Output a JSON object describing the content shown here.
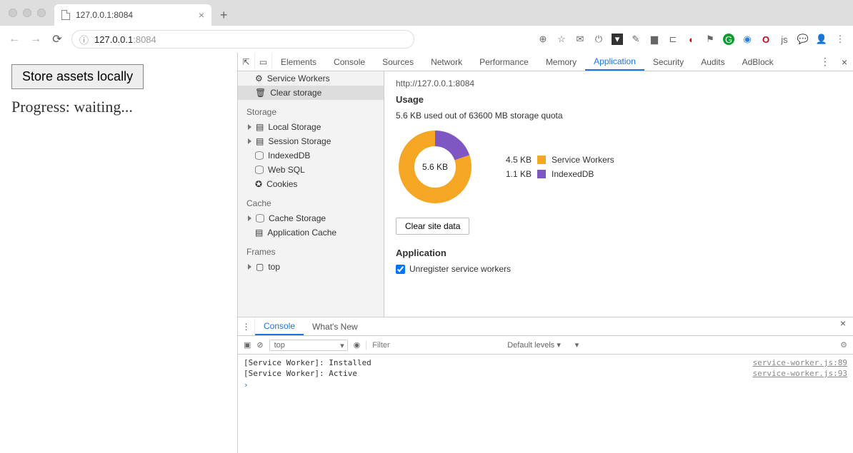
{
  "browser": {
    "tab_title": "127.0.0.1:8084",
    "address_host": "127.0.0.1",
    "address_port": ":8084"
  },
  "page": {
    "button_label": "Store assets locally",
    "progress_text": "Progress: waiting..."
  },
  "devtools": {
    "tabs": [
      "Elements",
      "Console",
      "Sources",
      "Network",
      "Performance",
      "Memory",
      "Application",
      "Security",
      "Audits",
      "AdBlock"
    ],
    "active_tab": "Application",
    "sidebar": {
      "top": [
        {
          "label": "Service Workers",
          "icon": "gear-icon"
        },
        {
          "label": "Clear storage",
          "icon": "trash-icon",
          "selected": true
        }
      ],
      "storage_label": "Storage",
      "storage": [
        {
          "label": "Local Storage",
          "expandable": true
        },
        {
          "label": "Session Storage",
          "expandable": true
        },
        {
          "label": "IndexedDB"
        },
        {
          "label": "Web SQL"
        },
        {
          "label": "Cookies"
        }
      ],
      "cache_label": "Cache",
      "cache": [
        {
          "label": "Cache Storage",
          "expandable": true
        },
        {
          "label": "Application Cache"
        }
      ],
      "frames_label": "Frames",
      "frames": [
        {
          "label": "top",
          "expandable": true
        }
      ]
    },
    "clear_storage": {
      "origin": "http://127.0.0.1:8084",
      "usage_heading": "Usage",
      "usage_line": "5.6 KB used out of 63600 MB storage quota",
      "donut_center": "5.6 KB",
      "legend": [
        {
          "value": "4.5 KB",
          "label": "Service Workers",
          "color": "#f5a623"
        },
        {
          "value": "1.1 KB",
          "label": "IndexedDB",
          "color": "#7e57c2"
        }
      ],
      "clear_button": "Clear site data",
      "application_heading": "Application",
      "checkbox_unregister": "Unregister service workers"
    },
    "drawer": {
      "tabs": [
        "Console",
        "What's New"
      ],
      "active_tab": "Console",
      "context": "top",
      "filter_placeholder": "Filter",
      "levels": "Default levels ▾",
      "lines": [
        {
          "text": "[Service Worker]: Installed",
          "src": "service-worker.js:89"
        },
        {
          "text": "[Service Worker]: Active",
          "src": "service-worker.js:93"
        }
      ]
    }
  },
  "chart_data": {
    "type": "pie",
    "title": "Storage usage",
    "series": [
      {
        "name": "Service Workers",
        "value": 4.5,
        "unit": "KB",
        "color": "#f5a623"
      },
      {
        "name": "IndexedDB",
        "value": 1.1,
        "unit": "KB",
        "color": "#7e57c2"
      }
    ],
    "total": {
      "value": 5.6,
      "unit": "KB"
    },
    "quota": {
      "value": 63600,
      "unit": "MB"
    }
  }
}
